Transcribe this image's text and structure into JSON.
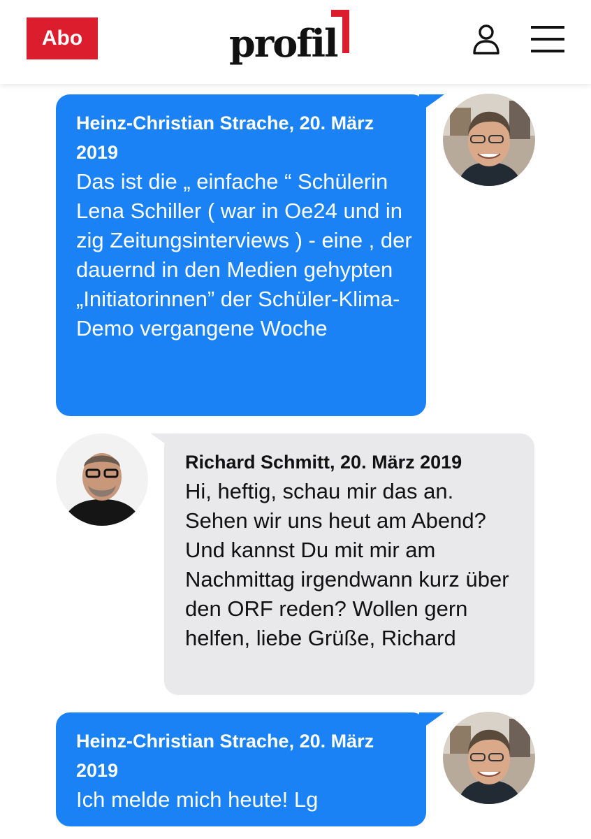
{
  "header": {
    "abo_label": "Abo",
    "logo_text": "profil",
    "brand_color": "#dc1d2e"
  },
  "messages": [
    {
      "sender": "Heinz-Christian Strache, 20. März 2019",
      "text": "Das ist die „ einfache “ Schülerin Lena Schiller ( war in Oe24 und in zig Zeitungsinterviews ) - eine , der dauernd in den Medien gehypten „Initiatorinnen” der Schüler-Klima-Demo vergangene Woche",
      "side": "right",
      "color": "#1a82f5"
    },
    {
      "sender": "Richard Schmitt, 20. März 2019",
      "text": "Hi, heftig, schau mir das an. Sehen wir uns heut am Abend? Und kannst Du mit mir am Nachmittag irgendwann kurz über den ORF reden? Wollen gern helfen, liebe Grüße, Richard",
      "side": "left",
      "color": "#e9e9ec"
    },
    {
      "sender": "Heinz-Christian Strache, 20. März 2019",
      "text": "Ich melde mich heute! Lg",
      "side": "right",
      "color": "#1a82f5"
    }
  ],
  "icons": [
    "user-icon",
    "hamburger-menu-icon",
    "avatar-photo"
  ]
}
